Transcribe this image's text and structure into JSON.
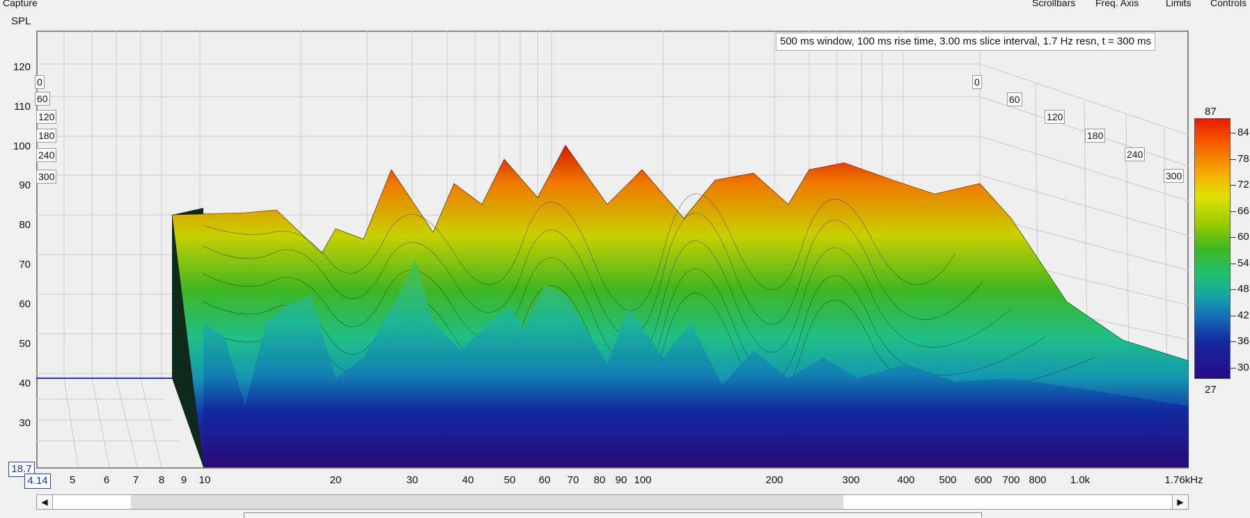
{
  "menu": {
    "capture": "Capture",
    "scrollbars": "Scrollbars",
    "freq_axis": "Freq. Axis",
    "limits": "Limits",
    "controls": "Controls"
  },
  "y_axis": {
    "label": "SPL",
    "ticks": [
      "120",
      "110",
      "100",
      "90",
      "80",
      "70",
      "60",
      "50",
      "40",
      "30"
    ],
    "min_value": "18.7"
  },
  "x_axis": {
    "min_value": "4.14",
    "ticks": [
      "5",
      "6",
      "7",
      "8",
      "9",
      "10",
      "20",
      "30",
      "40",
      "50",
      "60",
      "70",
      "80",
      "90",
      "100",
      "200",
      "300",
      "400",
      "500",
      "600",
      "700",
      "800",
      "1.0k",
      "1.76kHz"
    ]
  },
  "time_axis": {
    "left": [
      "0",
      "60",
      "120",
      "180",
      "240",
      "300"
    ],
    "right": [
      "0",
      "60",
      "120",
      "180",
      "240",
      "300"
    ]
  },
  "info": "500 ms window, 100 ms rise time, 3.00 ms slice interval, 1.7 Hz resn, t = 300 ms",
  "legend": {
    "max": "87",
    "min": "27",
    "ticks": [
      "84",
      "78",
      "72",
      "66",
      "60",
      "54",
      "48",
      "42",
      "36",
      "30"
    ]
  },
  "colors": {
    "high": "#e81a00",
    "mid": "#3eb620",
    "low": "#2a0a88",
    "frame": "#888888"
  },
  "scrollbar": {
    "left_arrow": "◀",
    "right_arrow": "▶"
  }
}
